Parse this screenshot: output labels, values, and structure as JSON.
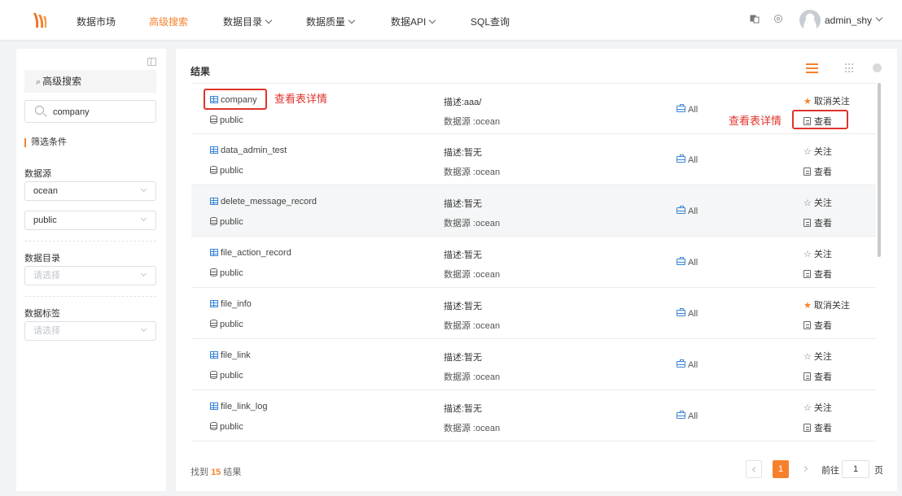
{
  "nav": {
    "items": [
      {
        "label": "数据市场",
        "active": false,
        "dropdown": false
      },
      {
        "label": "高级搜索",
        "active": true,
        "dropdown": false
      },
      {
        "label": "数据目录",
        "active": false,
        "dropdown": true
      },
      {
        "label": "数据质量",
        "active": false,
        "dropdown": true
      },
      {
        "label": "数据API",
        "active": false,
        "dropdown": true
      },
      {
        "label": "SQL查询",
        "active": false,
        "dropdown": false
      }
    ],
    "user": "admin_shy",
    "accent_color": "#f5812c"
  },
  "sidebar": {
    "header": "高级搜索",
    "search_value": "company",
    "filter_title": "筛选条件",
    "datasource_label": "数据源",
    "datasource_value": "ocean",
    "schema_value": "public",
    "catalog_label": "数据目录",
    "catalog_placeholder": "请选择",
    "tag_label": "数据标签",
    "tag_placeholder": "请选择"
  },
  "results": {
    "title": "结果",
    "desc_prefix": "描述:",
    "rows": [
      {
        "name": "company",
        "schema": "public",
        "desc": "描述:aaa/",
        "source": "数据源 :ocean",
        "scope": "All",
        "followed": true,
        "follow_label": "取消关注",
        "view_label": "查看"
      },
      {
        "name": "data_admin_test",
        "schema": "public",
        "desc": "描述:暂无",
        "source": "数据源 :ocean",
        "scope": "All",
        "followed": false,
        "follow_label": "关注",
        "view_label": "查看"
      },
      {
        "name": "delete_message_record",
        "schema": "public",
        "desc": "描述:暂无",
        "source": "数据源 :ocean",
        "scope": "All",
        "followed": false,
        "follow_label": "关注",
        "view_label": "查看"
      },
      {
        "name": "file_action_record",
        "schema": "public",
        "desc": "描述:暂无",
        "source": "数据源 :ocean",
        "scope": "All",
        "followed": false,
        "follow_label": "关注",
        "view_label": "查看"
      },
      {
        "name": "file_info",
        "schema": "public",
        "desc": "描述:暂无",
        "source": "数据源 :ocean",
        "scope": "All",
        "followed": true,
        "follow_label": "取消关注",
        "view_label": "查看"
      },
      {
        "name": "file_link",
        "schema": "public",
        "desc": "描述:暂无",
        "source": "数据源 :ocean",
        "scope": "All",
        "followed": false,
        "follow_label": "关注",
        "view_label": "查看"
      },
      {
        "name": "file_link_log",
        "schema": "public",
        "desc": "描述:暂无",
        "source": "数据源 :ocean",
        "scope": "All",
        "followed": false,
        "follow_label": "关注",
        "view_label": "查看"
      }
    ],
    "found_prefix": "找到",
    "found_count": "15",
    "found_suffix": "结果"
  },
  "annotations": {
    "left_label": "查看表详情",
    "right_label": "查看表详情",
    "color": "#e0332b"
  },
  "pagination": {
    "current_page": "1",
    "goto_label": "前往",
    "goto_value": "1",
    "page_suffix": "页"
  }
}
